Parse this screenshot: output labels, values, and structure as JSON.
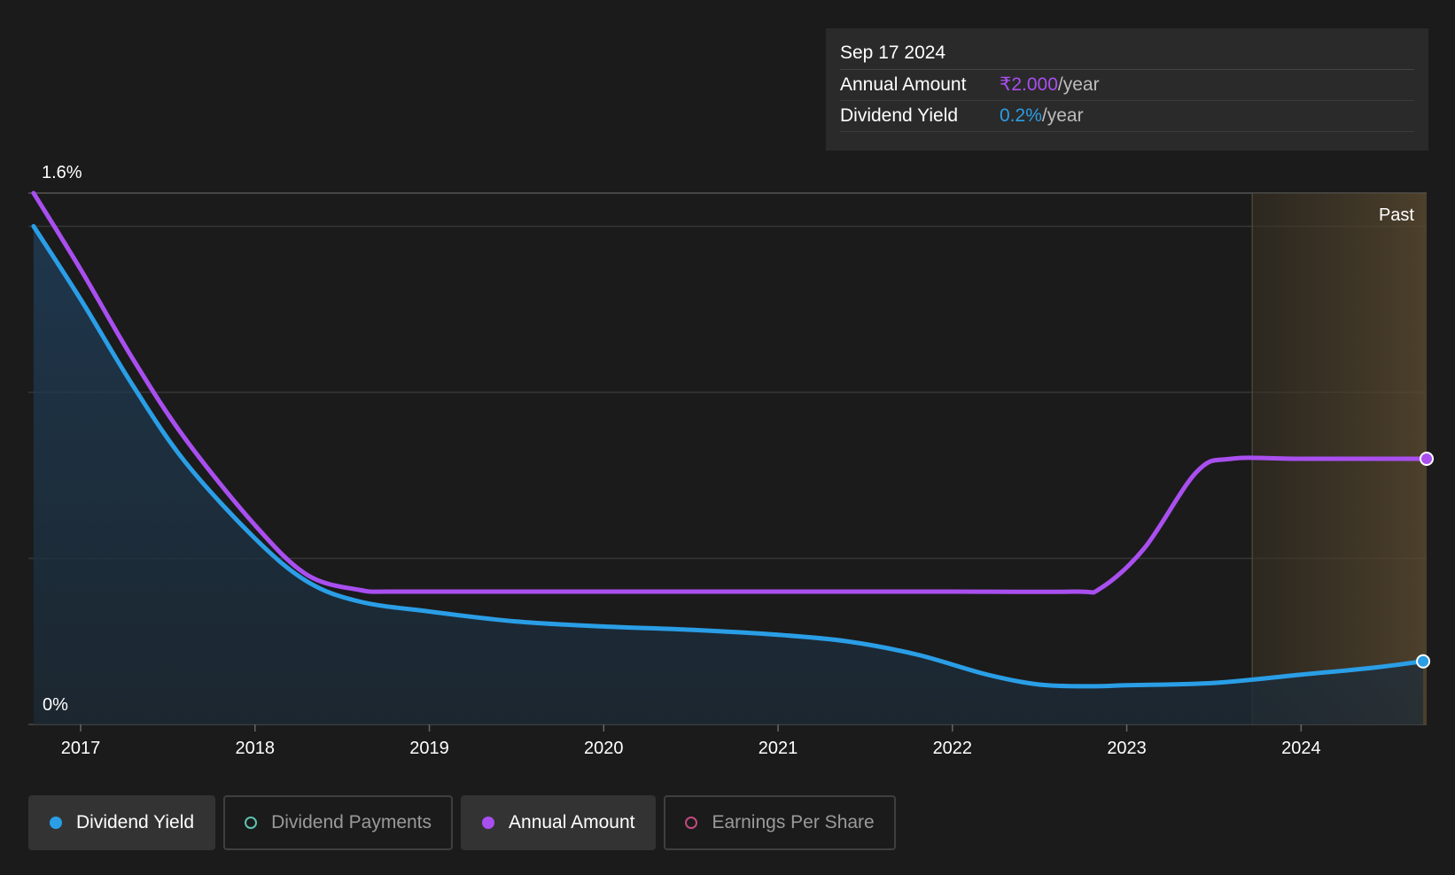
{
  "tooltip": {
    "date": "Sep 17 2024",
    "rows": [
      {
        "label": "Annual Amount",
        "value": "₹2.000",
        "unit": "/year",
        "color": "#a94ff0"
      },
      {
        "label": "Dividend Yield",
        "value": "0.2%",
        "unit": "/year",
        "color": "#2a9ee6"
      }
    ]
  },
  "past_label": "Past",
  "legend": [
    {
      "label": "Dividend Yield",
      "active": true,
      "color": "#2a9ee6"
    },
    {
      "label": "Dividend Payments",
      "active": false,
      "color": "#5dc2b0"
    },
    {
      "label": "Annual Amount",
      "active": true,
      "color": "#a94ff0"
    },
    {
      "label": "Earnings Per Share",
      "active": false,
      "color": "#c04a7e"
    }
  ],
  "chart_data": {
    "type": "line",
    "x_ticks": [
      "2017",
      "2018",
      "2019",
      "2020",
      "2021",
      "2022",
      "2023",
      "2024"
    ],
    "y_axis_labels": {
      "top": "1.6%",
      "bottom": "0%"
    },
    "ylim": [
      0,
      1.6
    ],
    "xlim": [
      2016.7,
      2024.72
    ],
    "past_region_start": 2023.72,
    "grid": true,
    "series": [
      {
        "name": "Dividend Yield",
        "color": "#2a9ee6",
        "filled": true,
        "points": [
          [
            2016.73,
            1.5
          ],
          [
            2017.0,
            1.28
          ],
          [
            2017.3,
            1.02
          ],
          [
            2017.6,
            0.79
          ],
          [
            2018.0,
            0.56
          ],
          [
            2018.3,
            0.43
          ],
          [
            2018.6,
            0.37
          ],
          [
            2019.0,
            0.34
          ],
          [
            2019.5,
            0.31
          ],
          [
            2020.0,
            0.295
          ],
          [
            2020.5,
            0.285
          ],
          [
            2021.0,
            0.27
          ],
          [
            2021.4,
            0.25
          ],
          [
            2021.8,
            0.21
          ],
          [
            2022.2,
            0.15
          ],
          [
            2022.5,
            0.12
          ],
          [
            2022.8,
            0.115
          ],
          [
            2023.0,
            0.118
          ],
          [
            2023.5,
            0.125
          ],
          [
            2024.0,
            0.15
          ],
          [
            2024.4,
            0.17
          ],
          [
            2024.7,
            0.19
          ]
        ]
      },
      {
        "name": "Annual Amount",
        "color": "#a94ff0",
        "filled": false,
        "points": [
          [
            2016.73,
            1.6
          ],
          [
            2017.0,
            1.37
          ],
          [
            2017.3,
            1.1
          ],
          [
            2017.6,
            0.86
          ],
          [
            2018.0,
            0.6
          ],
          [
            2018.3,
            0.45
          ],
          [
            2018.6,
            0.405
          ],
          [
            2018.8,
            0.4
          ],
          [
            2019.5,
            0.4
          ],
          [
            2020.5,
            0.4
          ],
          [
            2021.5,
            0.4
          ],
          [
            2022.0,
            0.4
          ],
          [
            2022.7,
            0.4
          ],
          [
            2022.85,
            0.41
          ],
          [
            2023.1,
            0.53
          ],
          [
            2023.4,
            0.76
          ],
          [
            2023.6,
            0.8
          ],
          [
            2024.0,
            0.8
          ],
          [
            2024.72,
            0.8
          ]
        ]
      }
    ]
  }
}
